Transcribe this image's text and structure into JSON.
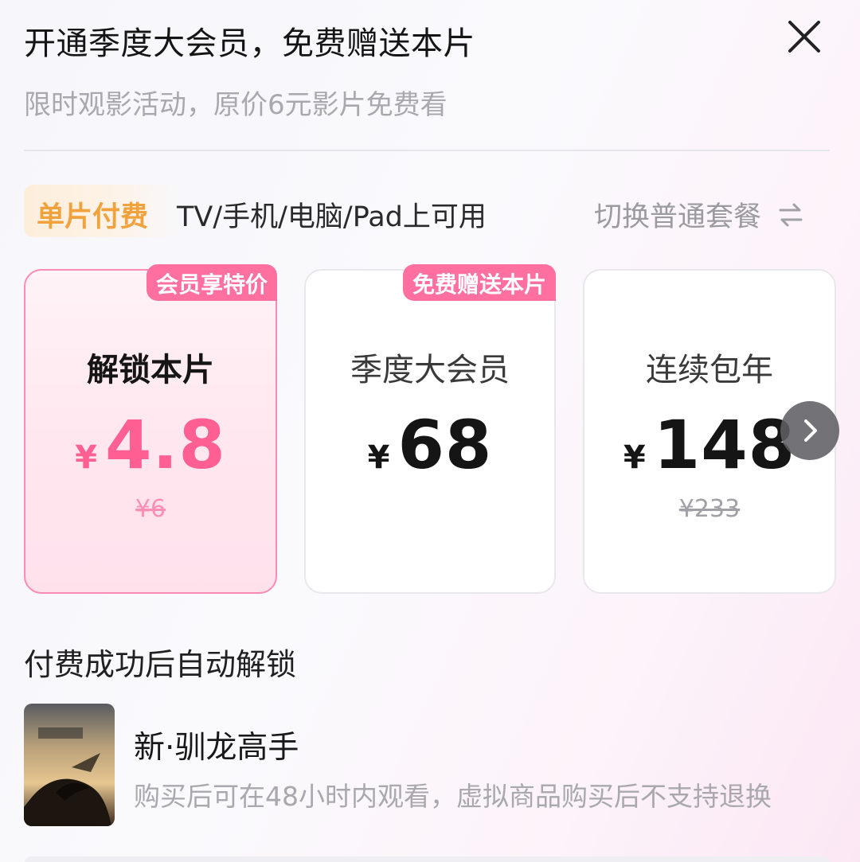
{
  "header": {
    "title": "开通季度大会员，免费赠送本片",
    "subtitle": "限时观影活动，原价6元影片免费看",
    "close_icon": "close-icon"
  },
  "plan_bar": {
    "badge": "单片付费",
    "devices": "TV/手机/电脑/Pad上可用",
    "switch_label": "切换普通套餐",
    "switch_icon": "swap-arrows-icon"
  },
  "cards": [
    {
      "tag": "会员享特价",
      "name": "解锁本片",
      "currency": "¥",
      "price": "4.8",
      "original_price": "¥6",
      "selected": true
    },
    {
      "tag": "免费赠送本片",
      "name": "季度大会员",
      "currency": "¥",
      "price": "68",
      "original_price": "",
      "selected": false
    },
    {
      "tag": "",
      "name": "连续包年",
      "currency": "¥",
      "price": "148",
      "original_price": "¥233",
      "selected": false
    }
  ],
  "next_icon": "chevron-right-icon",
  "unlock_note": "付费成功后自动解锁",
  "movie": {
    "title": "新·驯龙高手",
    "note": "购买后可在48小时内观看，虚拟商品购买后不支持退换"
  },
  "colors": {
    "accent_pink": "#ff5f93",
    "tag_pink": "#ff6f9f",
    "badge_orange": "#f2a23c"
  }
}
